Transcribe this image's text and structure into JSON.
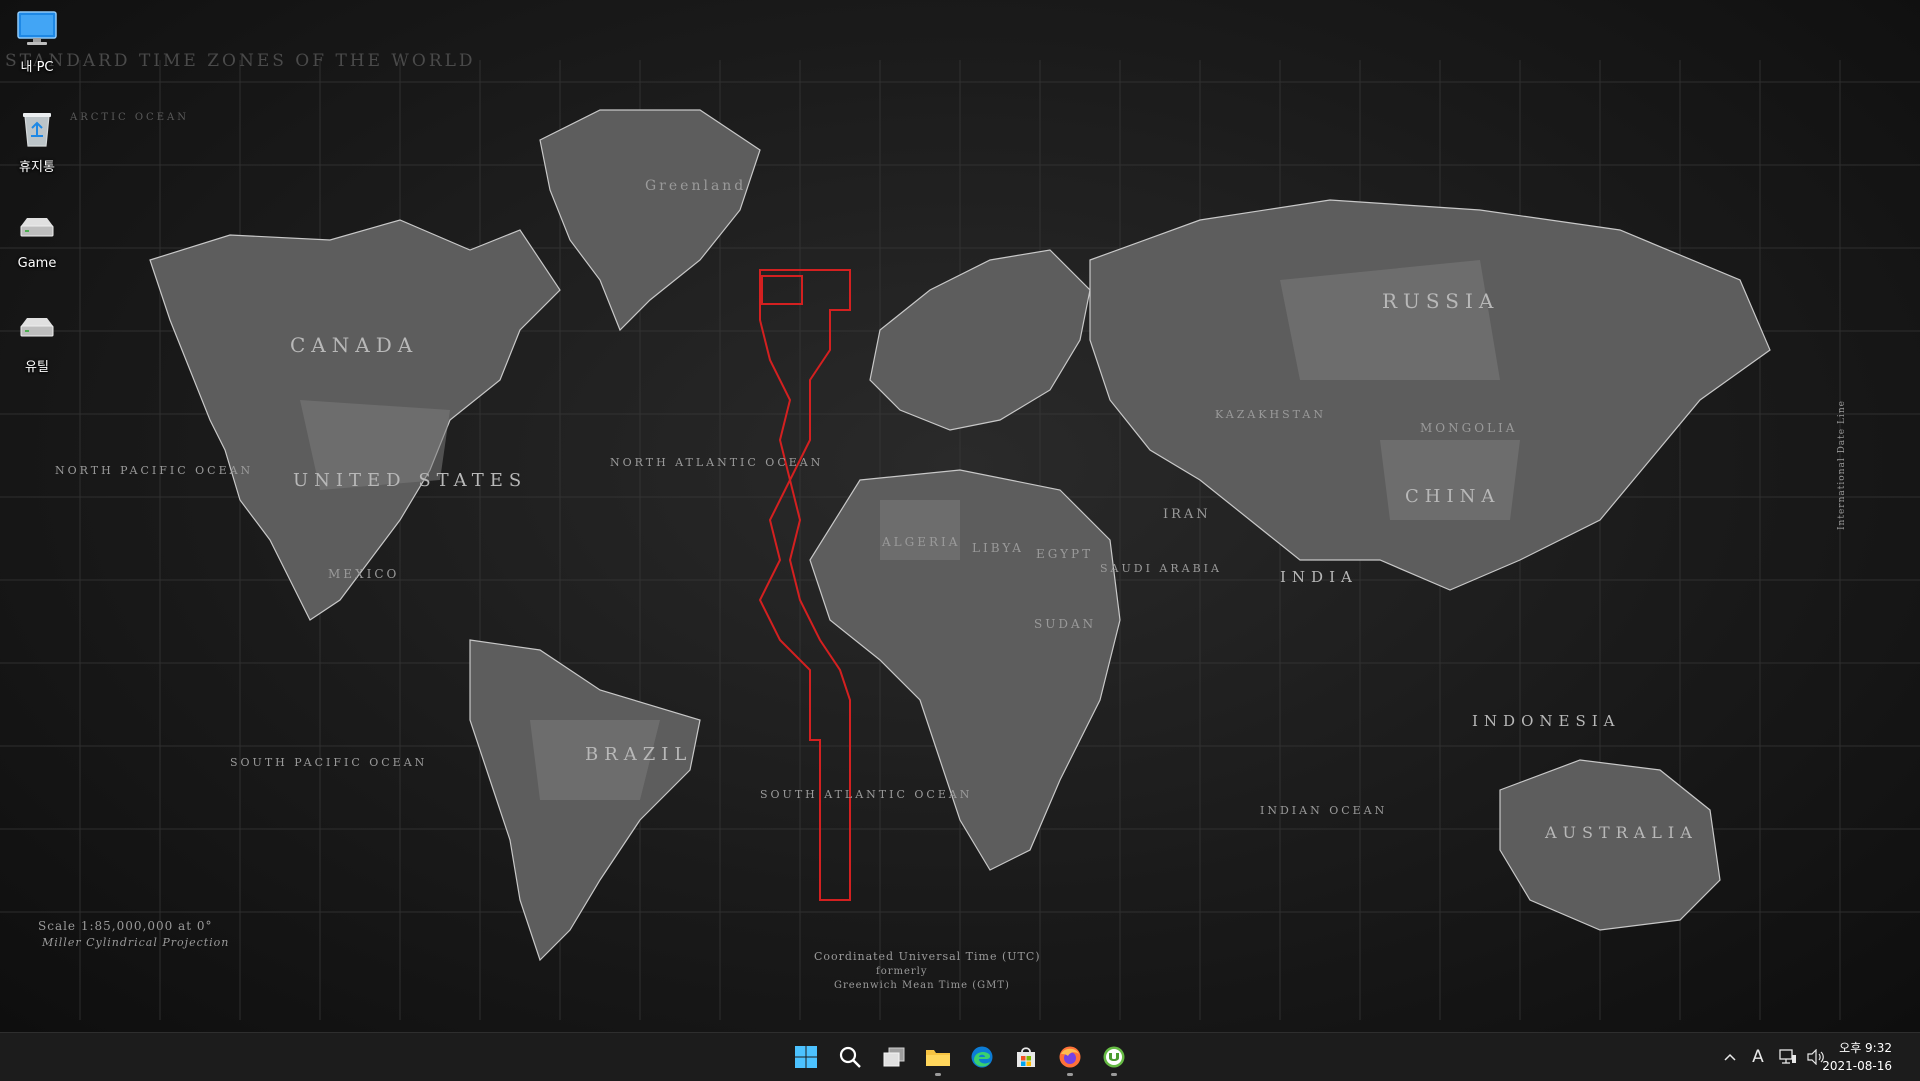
{
  "wallpaper": {
    "title": "STANDARD TIME ZONES OF THE WORLD",
    "regions": {
      "canada": "CANADA",
      "united_states": "UNITED STATES",
      "russia": "RUSSIA",
      "china": "CHINA",
      "brazil": "BRAZIL",
      "australia": "AUSTRALIA",
      "india": "INDIA",
      "indonesia": "INDONESIA",
      "greenland": "Greenland",
      "mexico": "MEXICO",
      "algeria": "ALGERIA",
      "libya": "LIBYA",
      "egypt": "EGYPT",
      "sudan": "SUDAN",
      "kazakhstan": "KAZAKHSTAN",
      "mongolia": "MONGOLIA",
      "iran": "IRAN",
      "saudi_arabia": "SAUDI ARABIA",
      "north_pacific": "NORTH PACIFIC OCEAN",
      "north_atlantic": "NORTH ATLANTIC OCEAN",
      "south_pacific": "SOUTH PACIFIC OCEAN",
      "south_atlantic": "SOUTH ATLANTIC OCEAN",
      "indian_ocean": "INDIAN OCEAN",
      "arctic": "ARCTIC OCEAN"
    },
    "scale": "Scale 1:85,000,000 at 0°",
    "projection": "Miller Cylindrical Projection",
    "utc_note": "Coordinated Universal Time (UTC)",
    "utc_note2": "formerly",
    "utc_note3": "Greenwich Mean Time (GMT)",
    "date_line": "International Date Line"
  },
  "desktop_icons": [
    {
      "label": "내 PC",
      "icon": "monitor-icon"
    },
    {
      "label": "휴지통",
      "icon": "recycle-bin-icon"
    },
    {
      "label": "Game",
      "icon": "drive-icon"
    },
    {
      "label": "유틸",
      "icon": "drive-icon"
    }
  ],
  "taskbar": {
    "apps": [
      {
        "name": "start",
        "icon": "windows-logo-icon"
      },
      {
        "name": "search",
        "icon": "search-icon"
      },
      {
        "name": "task-view",
        "icon": "task-view-icon"
      },
      {
        "name": "file-explorer",
        "icon": "folder-icon"
      },
      {
        "name": "edge",
        "icon": "edge-icon"
      },
      {
        "name": "store",
        "icon": "store-icon"
      },
      {
        "name": "firefox",
        "icon": "firefox-icon"
      },
      {
        "name": "utorrent",
        "icon": "utorrent-icon"
      }
    ],
    "tray": {
      "ime": "A",
      "time": "오후 9:32",
      "date": "2021-08-16"
    }
  },
  "colors": {
    "taskbar_bg": "#1c1c1c",
    "map_land": "#5a5a5a",
    "utc_zone_border": "#d42020"
  }
}
